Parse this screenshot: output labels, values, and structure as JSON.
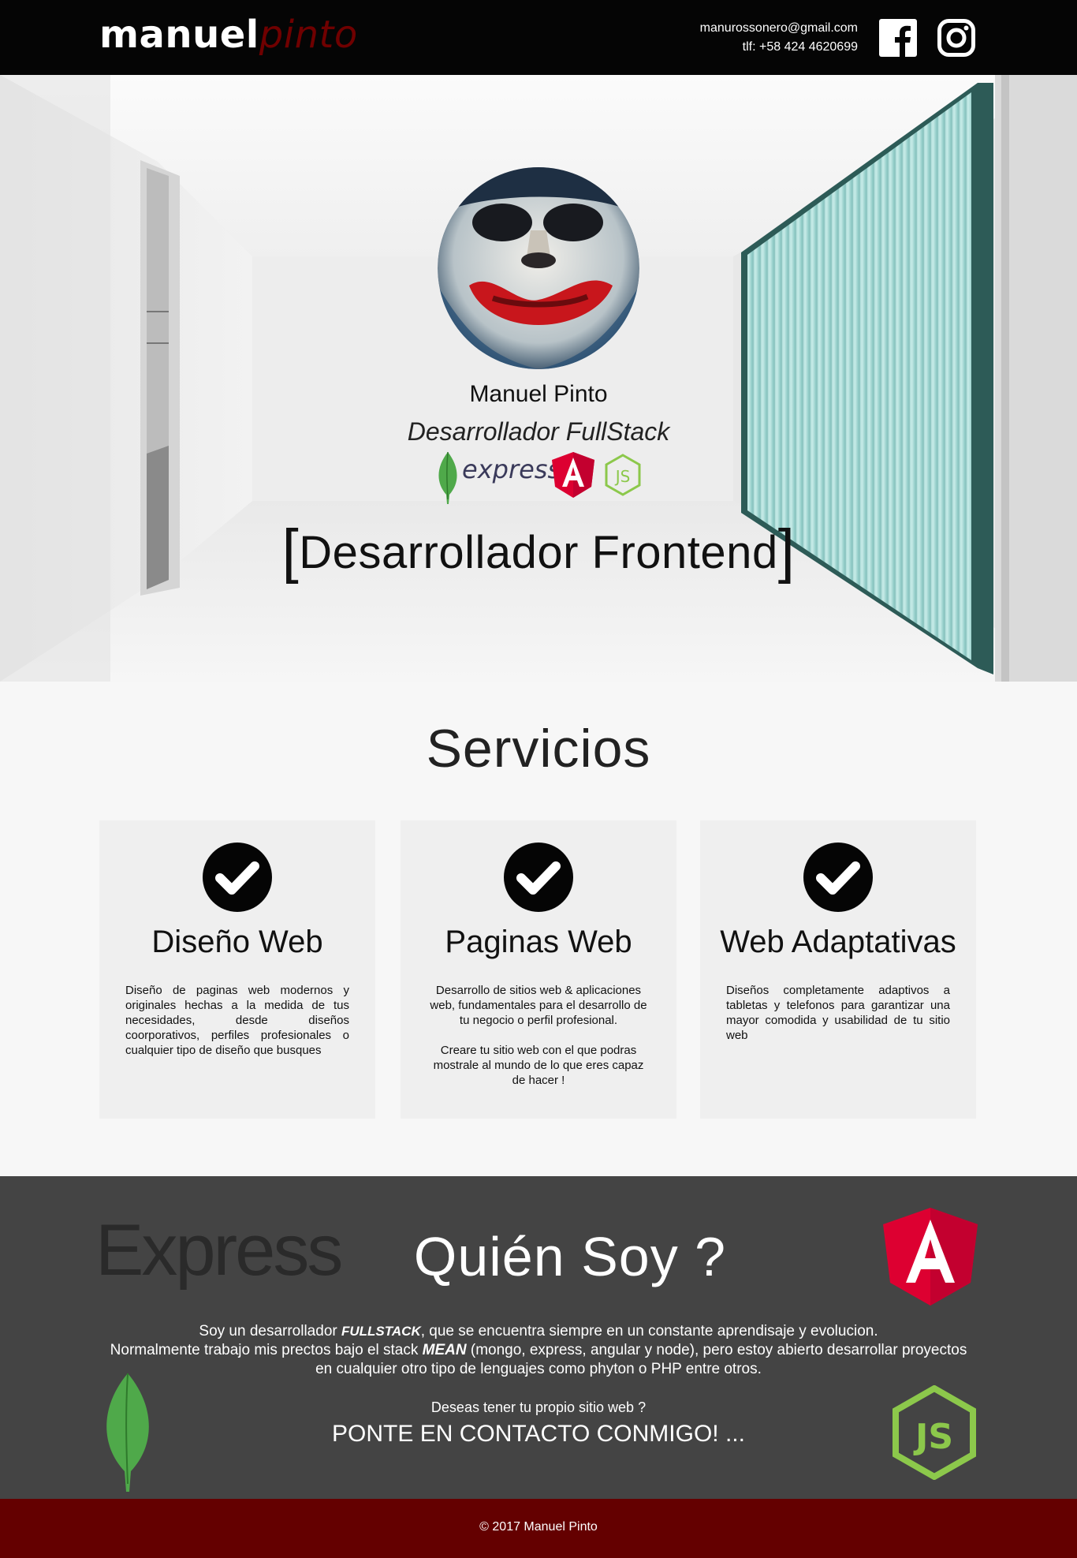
{
  "header": {
    "logo_first": "manuel",
    "logo_second": "pinto",
    "email": "manurossonero@gmail.com",
    "phone": "tlf: +58 424 4620699",
    "social_icons": [
      "facebook-icon",
      "instagram-icon"
    ]
  },
  "hero": {
    "name": "Manuel Pinto",
    "role": "Desarrollador FullStack",
    "tech_express": "express",
    "tech_icons": [
      "mongodb-icon",
      "express-logo",
      "angular-icon",
      "nodejs-icon"
    ],
    "typed_text": "Desarrollador Frontend",
    "bracket_open": "[",
    "bracket_close": "]"
  },
  "services": {
    "title": "Servicios",
    "cards": [
      {
        "icon": "check-icon",
        "title": "Diseño Web",
        "text": "Diseño de paginas web modernos y originales hechas a la medida de tus necesidades, desde diseños coorporativos, perfiles profesionales o cualquier tipo de diseño que busques"
      },
      {
        "icon": "check-icon",
        "title": "Paginas Web",
        "text": "Desarrollo de sitios web & aplicaciones web, fundamentales para el desarrollo de tu negocio o perfil profesional.",
        "text2": "Creare tu sitio web con el que podras mostrale al mundo de lo que eres capaz de hacer !"
      },
      {
        "icon": "check-icon",
        "title": "Web Adaptativas",
        "text": "Diseños completamente adaptivos a tabletas y telefonos para garantizar una mayor comodida y usabilidad de tu sitio web"
      }
    ]
  },
  "about": {
    "express_word": "Express",
    "title": "Quién Soy ?",
    "line1_pre": "Soy un desarrollador ",
    "line1_em": "FULLSTACK",
    "line1_post": ", que se encuentra siempre en un constante aprendisaje y evolucion.",
    "line2_pre": "Normalmente trabajo mis prectos bajo el stack ",
    "line2_em": "MEAN",
    "line2_post": " (mongo, express, angular y node),  pero estoy abierto desarrollar proyectos en cualquier otro tipo de lenguajes como phyton o PHP entre otros.",
    "question": "Deseas tener tu propio sitio web ?",
    "cta": "PONTE EN CONTACTO CONMIGO! ..."
  },
  "footer": {
    "text": "© 2017 Manuel Pinto"
  },
  "colors": {
    "header_bg": "#050505",
    "brand_red": "#6f0000",
    "footer_bg": "#640000",
    "about_bg": "#444444",
    "angular_red": "#dd0031",
    "node_green": "#8cc84b",
    "mongo_green": "#4fa94a"
  }
}
